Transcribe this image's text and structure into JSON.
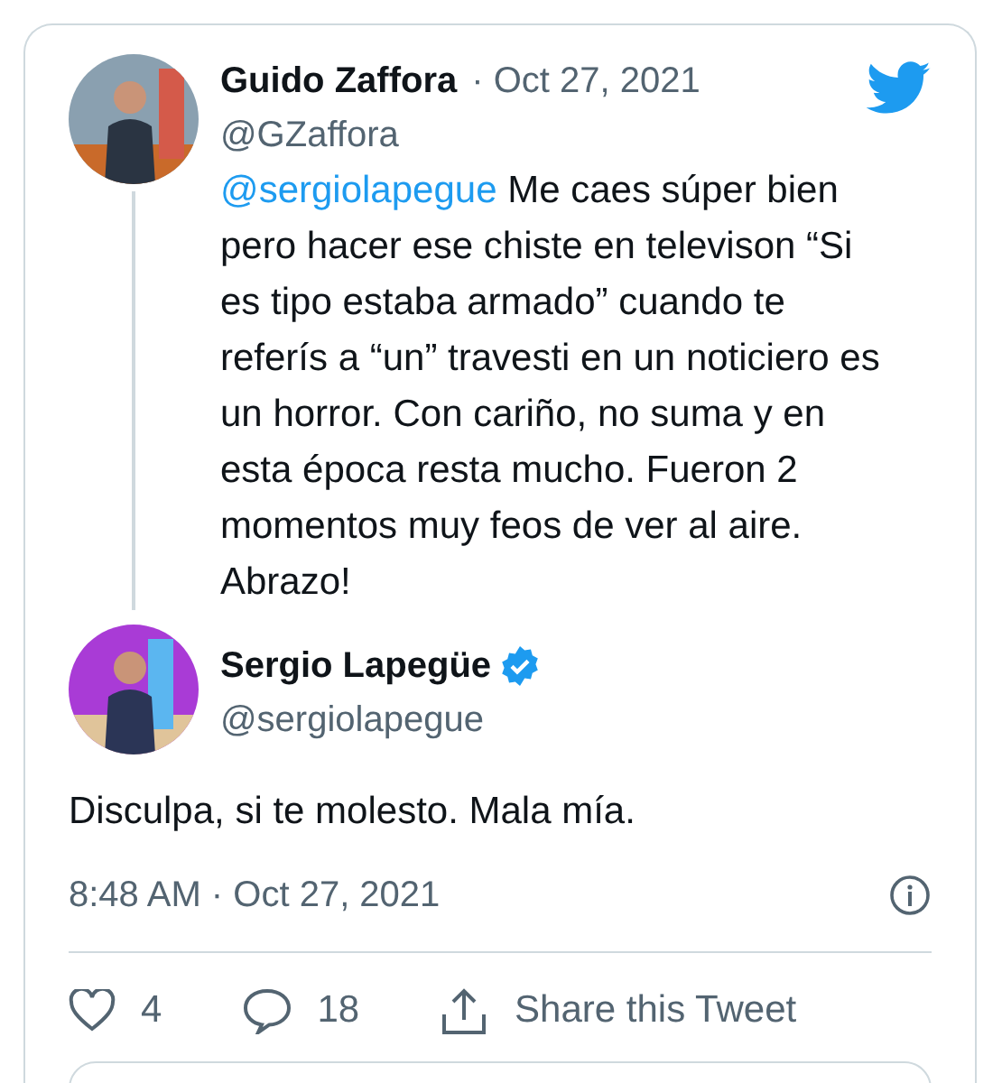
{
  "tweet": {
    "author": {
      "name": "Guido Zaffora",
      "date": "· Oct 27, 2021",
      "handle": "@GZaffora"
    },
    "mention": "@sergiolapegue",
    "text": "Me caes súper bien pero hacer ese chiste en televison “Si es tipo estaba armado” cuando te referís a “un” travesti en un noticiero es un horror. Con cariño, no suma y en esta época resta mucho. Fueron 2 momentos muy feos de ver al aire. Abrazo!"
  },
  "reply": {
    "author": {
      "name": "Sergio Lapegüe",
      "handle": "@sergiolapegue",
      "verified": true
    },
    "text": "Disculpa, si te molesto. Mala mía.",
    "timestamp": "8:48 AM · Oct 27, 2021"
  },
  "actions": [
    {
      "kind": "like",
      "label": "4"
    },
    {
      "kind": "reply",
      "label": "18"
    },
    {
      "kind": "share",
      "label": "Share this Tweet"
    }
  ]
}
